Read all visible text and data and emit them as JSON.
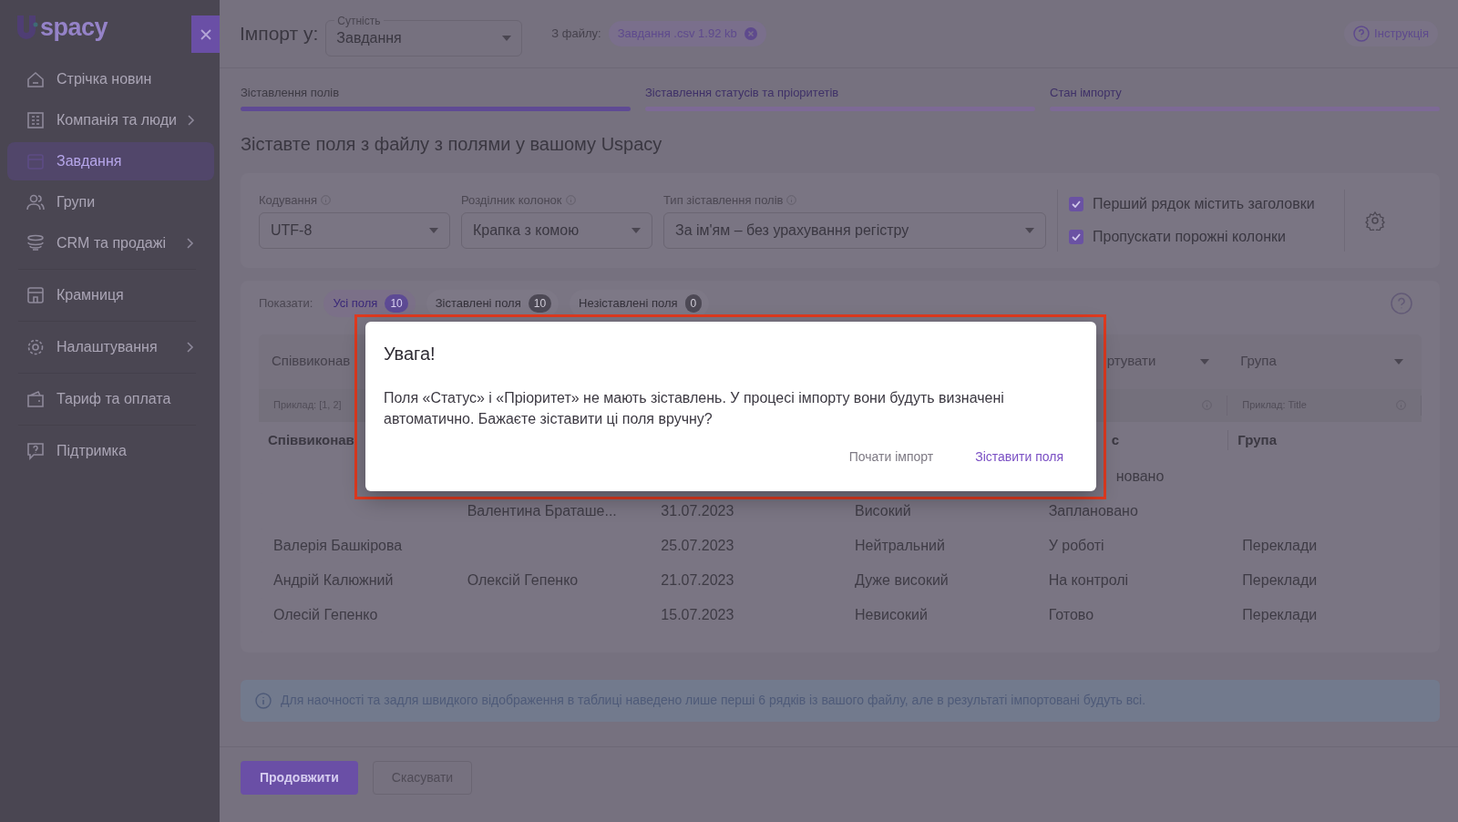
{
  "sidebar": {
    "logo": "spacy",
    "items": [
      {
        "label": "Стрічка новин",
        "submenu": false,
        "selected": false,
        "divider_before": false
      },
      {
        "label": "Компанія та люди",
        "submenu": true,
        "selected": false,
        "divider_before": false
      },
      {
        "label": "Завдання",
        "submenu": false,
        "selected": true,
        "divider_before": false
      },
      {
        "label": "Групи",
        "submenu": false,
        "selected": false,
        "divider_before": false
      },
      {
        "label": "CRM та продажі",
        "submenu": true,
        "selected": false,
        "divider_before": false
      },
      {
        "label": "Крамниця",
        "submenu": false,
        "selected": false,
        "divider_before": true
      },
      {
        "label": "Налаштування",
        "submenu": true,
        "selected": false,
        "divider_before": true
      },
      {
        "label": "Тариф та оплата",
        "submenu": false,
        "selected": false,
        "divider_before": true
      },
      {
        "label": "Підтримка",
        "submenu": false,
        "selected": false,
        "divider_before": true
      }
    ]
  },
  "header": {
    "title": "Імпорт у:",
    "entity": {
      "label": "Сутність",
      "value": "Завдання"
    },
    "file_label": "З файлу:",
    "file_name": "Завдання .csv 1.92 kb",
    "help": "Інструкція"
  },
  "steps": [
    {
      "label": "Зіставлення полів",
      "selected": true
    },
    {
      "label": "Зіставлення статусів та пріоритетів",
      "selected": false
    },
    {
      "label": "Стан імпорту",
      "selected": false
    }
  ],
  "heading": "Зіставте поля з файлу з полями у вашому Uspacy",
  "settings": {
    "selects": [
      {
        "label": "Кодування",
        "value": "UTF-8"
      },
      {
        "label": "Розділник колонок",
        "value": "Крапка з комою"
      },
      {
        "label": "Тип зіставлення полів",
        "value": "За ім'ям – без урахування регістру"
      }
    ],
    "checkboxes": [
      {
        "label": "Перший рядок містить заголовки",
        "checked": true
      },
      {
        "label": "Пропускати порожні колонки",
        "checked": true
      }
    ]
  },
  "filters": {
    "label": "Показати:",
    "chips": [
      {
        "label": "Усі поля",
        "count": "10",
        "selected": true
      },
      {
        "label": "Зіставлені поля",
        "count": "10",
        "selected": false
      },
      {
        "label": "Незіставлені поля",
        "count": "0",
        "selected": false
      }
    ]
  },
  "table": {
    "columns": [
      {
        "select": "Співвиконав",
        "example": "Приклад: [1, 2]",
        "header": "Співвиконав"
      },
      {},
      {},
      {},
      {
        "select": {
          "text": "ртувати",
          "cut": true
        },
        "example_info": true,
        "header": {
          "text": "с",
          "cut": true
        }
      },
      {
        "select": "Група",
        "example": "Приклад: Title",
        "example_info": true,
        "header": "Група"
      }
    ],
    "rows": [
      [
        null,
        null,
        null,
        null,
        {
          "text": "новано",
          "cut": true
        },
        null
      ],
      [
        null,
        "Валентина Браташе...",
        "31.07.2023",
        "Високий",
        "Заплановано",
        null
      ],
      [
        "Валерія Башкірова",
        null,
        "25.07.2023",
        "Нейтральний",
        "У роботі",
        "Переклади"
      ],
      [
        "Андрій Калюжний",
        "Олексій Гепенко",
        "21.07.2023",
        "Дуже високий",
        "На контролі",
        "Переклади"
      ],
      [
        "Олесій Гепенко",
        null,
        "15.07.2023",
        "Невисокий",
        "Готово",
        "Переклади"
      ]
    ]
  },
  "info": "Для наочності та задля швидкого відображення в таблиці наведено лише перші 6 рядків із вашого файлу, але в результаті імпортовані будуть всі.",
  "footer": {
    "primary": "Продовжити",
    "secondary": "Скасувати"
  },
  "dialog": {
    "title": "Увага!",
    "text": "Поля «Статус» і «Пріоритет» не мають зіставлень. У процесі імпорту вони будуть визначені автоматично. Бажаєте зіставити ці поля вручну?",
    "buttons": [
      {
        "label": "Почати імпорт",
        "primary": false
      },
      {
        "label": "Зіставити поля",
        "primary": true
      }
    ]
  }
}
